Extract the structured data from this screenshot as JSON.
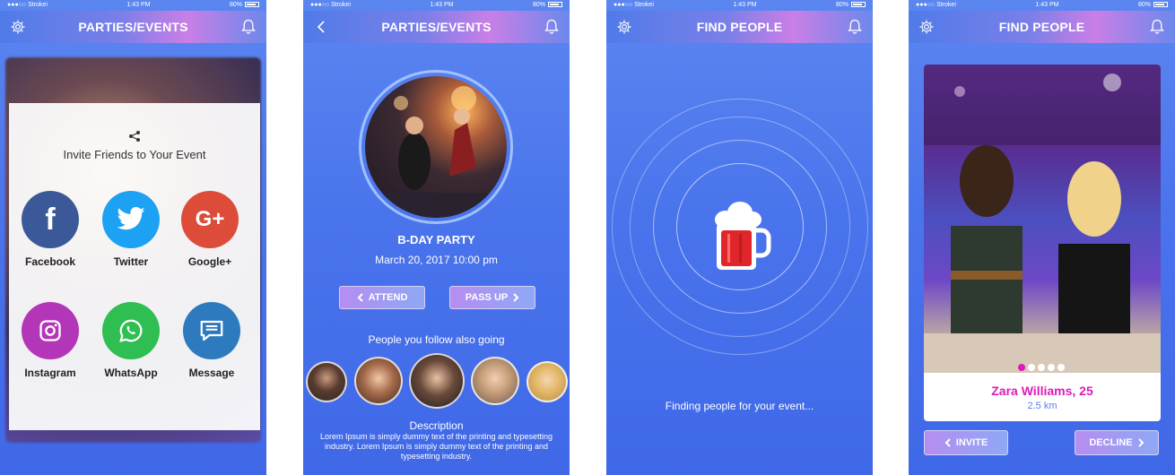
{
  "status": {
    "carrier": "●●●○○ Strokei",
    "time": "1:43 PM",
    "battery": "80%"
  },
  "screen1": {
    "title": "PARTIES/EVENTS",
    "share_title": "Invite Friends to Your Event",
    "apps": [
      {
        "label": "Facebook",
        "color": "#3b5998",
        "glyph": "f"
      },
      {
        "label": "Twitter",
        "color": "#1da1f2",
        "glyph": ""
      },
      {
        "label": "Google+",
        "color": "#dd4b39",
        "glyph": "G+"
      },
      {
        "label": "Instagram",
        "color": "#b436b8",
        "glyph": ""
      },
      {
        "label": "WhatsApp",
        "color": "#2fbe52",
        "glyph": ""
      },
      {
        "label": "Message",
        "color": "#2d7bbe",
        "glyph": ""
      }
    ]
  },
  "screen2": {
    "title": "PARTIES/EVENTS",
    "event_name": "B-DAY PARTY",
    "event_date": "March 20, 2017  10:00 pm",
    "attend": "ATTEND",
    "pass_up": "PASS UP",
    "follow_title": "People you follow also going",
    "desc_title": "Description",
    "desc_text": "Lorem Ipsum is simply dummy text of the printing and typesetting industry. Lorem Ipsum is simply dummy text of the printing and typesetting industry."
  },
  "screen3": {
    "title": "FIND PEOPLE",
    "finding": "Finding people for your event..."
  },
  "screen4": {
    "title": "FIND PEOPLE",
    "name": "Zara Williams, 25",
    "distance": "2.5 km",
    "invite": "INVITE",
    "decline": "DECLINE"
  },
  "colors": {
    "accent_pink": "#d91db5",
    "bg_blue": "#4a74ec"
  }
}
